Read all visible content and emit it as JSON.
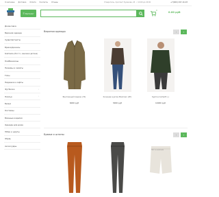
{
  "topbar": {
    "links": [
      "О магазине",
      "Доставка",
      "Оплата",
      "Контакты",
      "Отзывы"
    ],
    "address": "Ставрополь, проспект Кулакова, 43 · с 10:00 до 20:00",
    "phone": "+7(960) 297-16-93"
  },
  "header": {
    "catalog_label": "Каталог",
    "search_placeholder": "",
    "cart_count": "0",
    "cart_total": "0.00 руб"
  },
  "sidebar": {
    "items": [
      {
        "label": "Джинсовка",
        "chevron": false
      },
      {
        "label": "Верхняя одежда",
        "chevron": false
      },
      {
        "label": "Худи/свитшоты",
        "chevron": false
      },
      {
        "label": "Брюки/джинсы",
        "chevron": false
      },
      {
        "label": "Комплекты (M и т.п., женские и детские)",
        "chevron": false
      },
      {
        "label": "Комбинезоны",
        "chevron": false
      },
      {
        "label": "Пижамы и халаты",
        "chevron": false
      },
      {
        "label": "Топы",
        "chevron": false
      },
      {
        "label": "Пиджаки и кофты",
        "chevron": false
      },
      {
        "label": "Футболки",
        "chevron": true
      },
      {
        "label": "Платья",
        "chevron": true
      },
      {
        "label": "Бельё",
        "chevron": false
      },
      {
        "label": "Костюмы",
        "chevron": false
      },
      {
        "label": "Вязаные изделия",
        "chevron": false
      },
      {
        "label": "Одежда для дома",
        "chevron": false
      },
      {
        "label": "Юбки и шорты",
        "chevron": false
      },
      {
        "label": "Обувь",
        "chevron": false
      },
      {
        "label": "Аксессуары",
        "chevron": false
      }
    ]
  },
  "sections": [
    {
      "title": "Верхняя одежда",
      "products": [
        {
          "name": "Винтажный пиджак (70)",
          "price": "6000 руб",
          "color": "#7a6a46"
        },
        {
          "name": "Кожаная куртка Maxmaro (Ит)",
          "price": "3000 руб",
          "color": "#4b3d33"
        },
        {
          "name": "Куртка Carhartt (.)",
          "price": "14000 руб",
          "color": "#2f3f2a"
        }
      ]
    },
    {
      "title": "Брюки и штаны",
      "products": [
        {
          "name": "",
          "price": "",
          "color": "#b85a1e"
        },
        {
          "name": "",
          "price": "",
          "color": "#4a4a48"
        },
        {
          "name": "",
          "price": "",
          "color": "#e8e4dc",
          "placeholder": "Нет в наличии"
        }
      ]
    }
  ],
  "nav": {
    "prev": "‹",
    "next": "›"
  },
  "colors": {
    "accent": "#5cb85c"
  }
}
